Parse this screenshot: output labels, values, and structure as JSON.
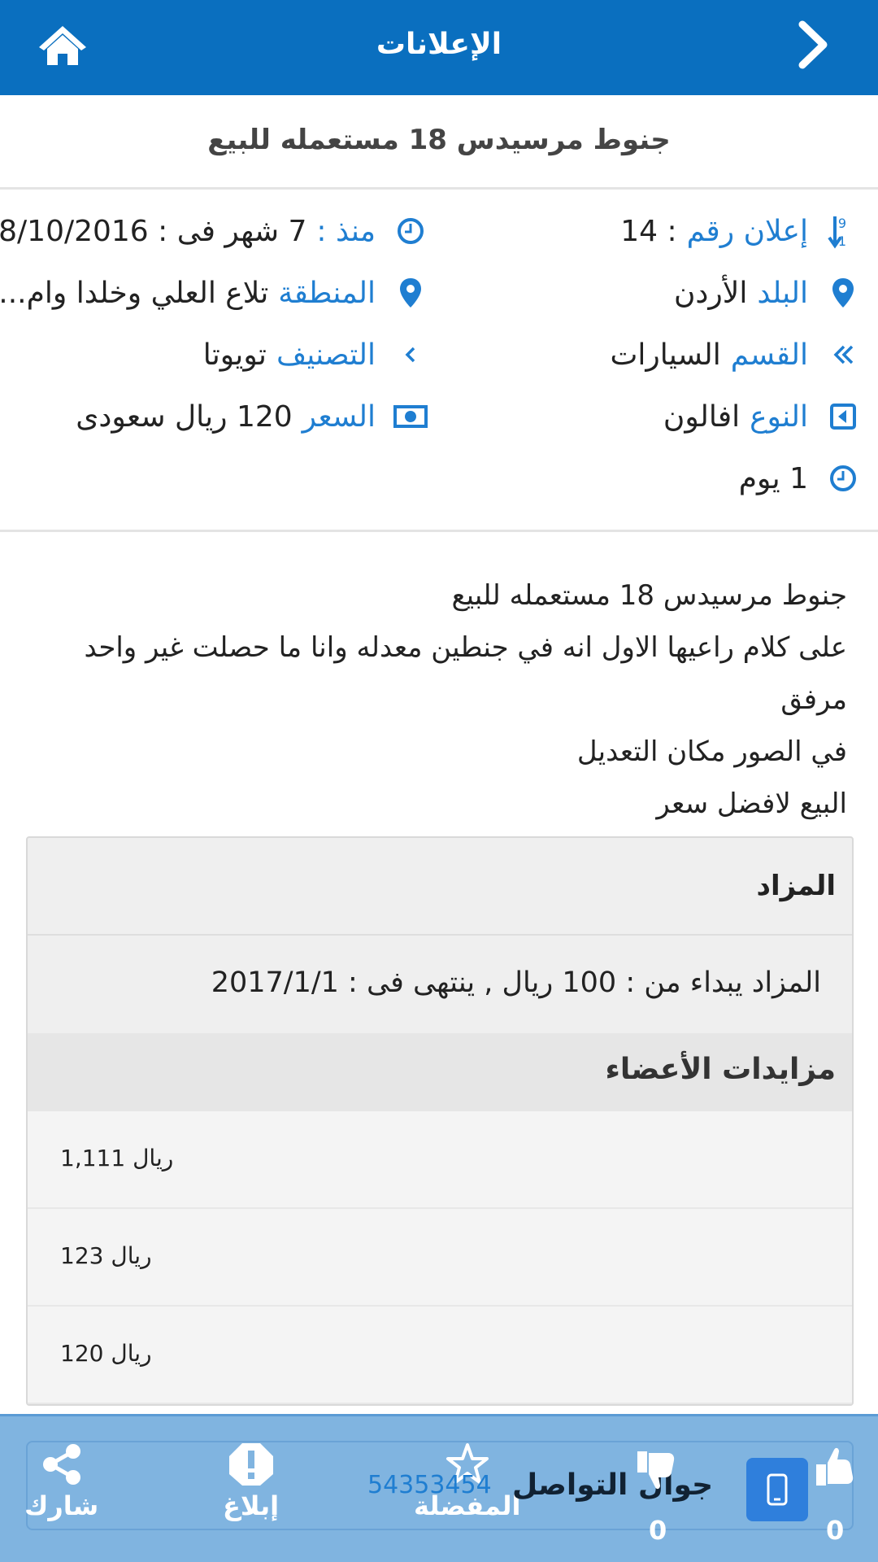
{
  "header": {
    "title": "الإعلانات"
  },
  "ad": {
    "title": "جنوط مرسيدس 18 مستعمله للبيع",
    "number_label": "إعلان رقم",
    "number_value": ": 14",
    "since_label": "منذ :",
    "since_value": "7 شهر فى : 8/10/2016",
    "country_label": "البلد",
    "country_value": "الأردن",
    "region_label": "المنطقة",
    "region_value": "تلاع العلي وخلدا وام...",
    "section_label": "القسم",
    "section_value": "السيارات",
    "category_label": "التصنيف",
    "category_value": "تويوتا",
    "type_label": "النوع",
    "type_value": "افالون",
    "price_label": "السعر",
    "price_value": "120 ريال سعودى",
    "duration_value": "1 يوم"
  },
  "description": [
    "جنوط مرسيدس 18 مستعمله للبيع",
    "على كلام راعيها الاول انه في جنطين معدله وانا ما حصلت غير واحد مرفق",
    "في الصور مكان التعديل",
    "البيع لافضل سعر"
  ],
  "auction": {
    "title": "المزاد",
    "info": "المزاد يبداء من : 100 ريال , ينتهى فى : 2017/1/1",
    "bids_title": "مزايدات الأعضاء",
    "bids": [
      "ريال 1,111",
      "ريال 123",
      "ريال 120"
    ]
  },
  "bottom": {
    "share": "شارك",
    "report": "إبلاغ",
    "favorite": "المفضلة",
    "contact_label": "جوال التواصل",
    "phone": "54353454",
    "dislikes": "0",
    "likes": "0"
  },
  "colors": {
    "primary": "#0a6fbf",
    "link": "#1f7ed1",
    "bottom_bar": "#80b4e0"
  }
}
